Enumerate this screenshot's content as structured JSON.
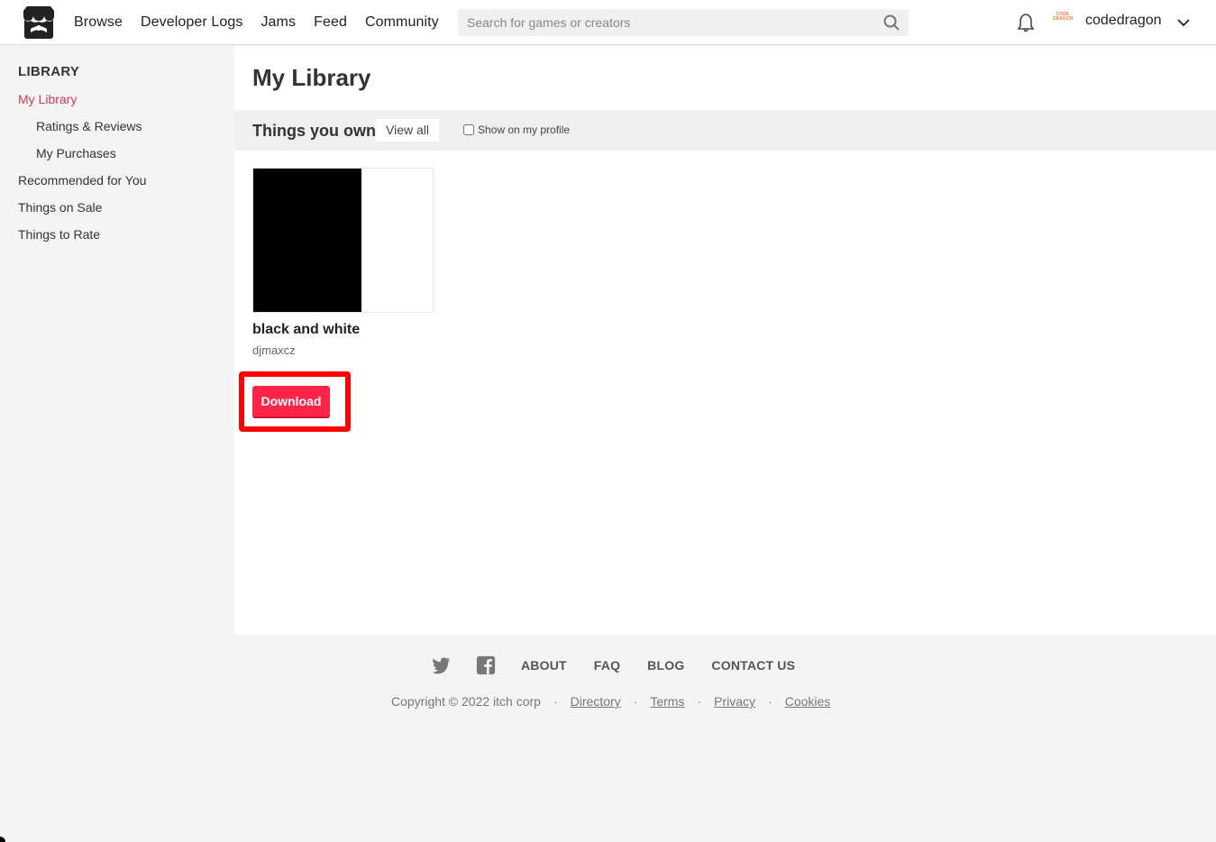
{
  "header": {
    "nav": [
      "Browse",
      "Developer Logs",
      "Jams",
      "Feed",
      "Community"
    ],
    "search_placeholder": "Search for games or creators",
    "avatar_text": "CODE DRAGON",
    "username": "codedragon"
  },
  "sidebar": {
    "heading": "LIBRARY",
    "items": [
      {
        "label": "My Library",
        "active": true
      },
      {
        "label": "Ratings & Reviews"
      },
      {
        "label": "My Purchases"
      },
      {
        "label": "Recommended for You"
      },
      {
        "label": "Things on Sale"
      },
      {
        "label": "Things to Rate"
      }
    ]
  },
  "main": {
    "title": "My Library",
    "section_title": "Things you own",
    "view_all": "View all",
    "show_profile": "Show on my profile",
    "game": {
      "title": "black and white",
      "author": "djmaxcz",
      "download": "Download"
    }
  },
  "footer": {
    "links": [
      "ABOUT",
      "FAQ",
      "BLOG",
      "CONTACT US"
    ],
    "copyright": "Copyright © 2022 itch corp",
    "bottom_links": [
      "Directory",
      "Terms",
      "Privacy",
      "Cookies"
    ]
  },
  "colors": {
    "accent": "#ff2449",
    "active_link": "#d03b53",
    "highlight": "#ff0000"
  }
}
